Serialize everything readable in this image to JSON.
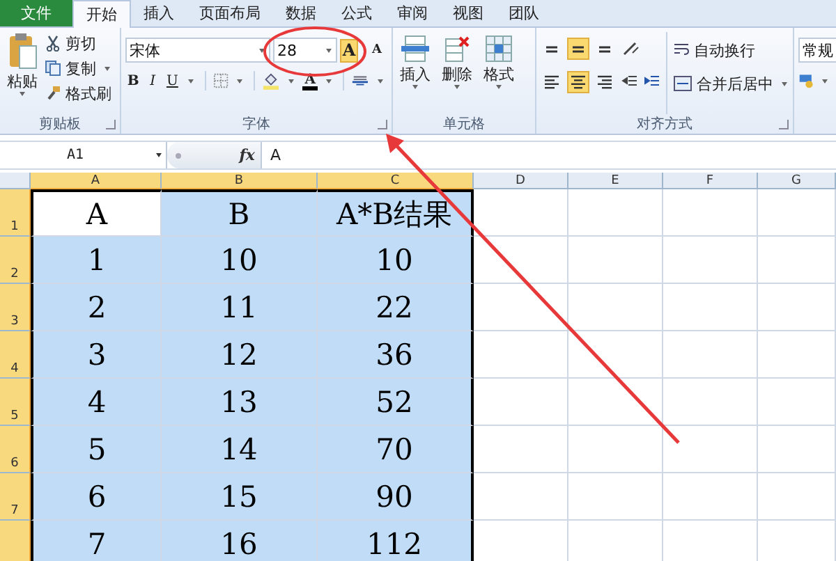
{
  "tabs": [
    {
      "label": "文件",
      "kind": "file",
      "selected": false
    },
    {
      "label": "开始",
      "kind": "tab",
      "selected": true
    },
    {
      "label": "插入",
      "kind": "tab",
      "selected": false
    },
    {
      "label": "页面布局",
      "kind": "tab",
      "selected": false
    },
    {
      "label": "数据",
      "kind": "tab",
      "selected": false
    },
    {
      "label": "公式",
      "kind": "tab",
      "selected": false
    },
    {
      "label": "审阅",
      "kind": "tab",
      "selected": false
    },
    {
      "label": "视图",
      "kind": "tab",
      "selected": false
    },
    {
      "label": "团队",
      "kind": "tab",
      "selected": false
    }
  ],
  "clipboard": {
    "paste": "粘贴",
    "cut": "剪切",
    "copy": "复制",
    "format_painter": "格式刷",
    "label": "剪贴板"
  },
  "font": {
    "font_name": "宋体",
    "font_size": "28",
    "grow": {
      "label": "A",
      "highlighted": true
    },
    "shrink": {
      "label": "A",
      "highlighted": false
    },
    "styles": [
      {
        "label": "B",
        "kind": "bold"
      },
      {
        "label": "I",
        "kind": "italic"
      },
      {
        "label": "U",
        "kind": "underline"
      }
    ],
    "font_color": "A",
    "label": "字体"
  },
  "cells": {
    "insert": "插入",
    "delete": "删除",
    "format": "格式",
    "label": "单元格"
  },
  "alignment": {
    "buttons": [
      {
        "kind": "top",
        "selected": false
      },
      {
        "kind": "middle",
        "selected": true
      },
      {
        "kind": "bottom",
        "selected": false
      },
      {
        "kind": "left",
        "selected": false
      },
      {
        "kind": "center",
        "selected": true
      },
      {
        "kind": "right",
        "selected": false
      }
    ],
    "wrap": "自动换行",
    "merge": "合并后居中",
    "label": "对齐方式"
  },
  "number": {
    "format": "常规"
  },
  "formula_bar": {
    "name_box": "A1",
    "function_label": "fx",
    "value": "A"
  },
  "sheet": {
    "columns": [
      {
        "label": "A",
        "selected": true
      },
      {
        "label": "B",
        "selected": true
      },
      {
        "label": "C",
        "selected": true
      },
      {
        "label": "D",
        "selected": false
      },
      {
        "label": "E",
        "selected": false
      },
      {
        "label": "F",
        "selected": false
      },
      {
        "label": "G",
        "selected": false
      }
    ],
    "rows": [
      {
        "number": "1",
        "selected": true,
        "cells": [
          {
            "text": "A",
            "selected": false
          },
          {
            "text": "B",
            "selected": true
          },
          {
            "text": "A*B结果",
            "selected": true
          }
        ]
      },
      {
        "number": "2",
        "selected": true,
        "cells": [
          {
            "text": "1",
            "selected": true
          },
          {
            "text": "10",
            "selected": true
          },
          {
            "text": "10",
            "selected": true
          }
        ]
      },
      {
        "number": "3",
        "selected": true,
        "cells": [
          {
            "text": "2",
            "selected": true
          },
          {
            "text": "11",
            "selected": true
          },
          {
            "text": "22",
            "selected": true
          }
        ]
      },
      {
        "number": "4",
        "selected": true,
        "cells": [
          {
            "text": "3",
            "selected": true
          },
          {
            "text": "12",
            "selected": true
          },
          {
            "text": "36",
            "selected": true
          }
        ]
      },
      {
        "number": "5",
        "selected": true,
        "cells": [
          {
            "text": "4",
            "selected": true
          },
          {
            "text": "13",
            "selected": true
          },
          {
            "text": "52",
            "selected": true
          }
        ]
      },
      {
        "number": "6",
        "selected": true,
        "cells": [
          {
            "text": "5",
            "selected": true
          },
          {
            "text": "14",
            "selected": true
          },
          {
            "text": "70",
            "selected": true
          }
        ]
      },
      {
        "number": "7",
        "selected": true,
        "cells": [
          {
            "text": "6",
            "selected": true
          },
          {
            "text": "15",
            "selected": true
          },
          {
            "text": "90",
            "selected": true
          }
        ]
      },
      {
        "selected": true,
        "cells": [
          {
            "text": "7",
            "selected": true
          },
          {
            "text": "16",
            "selected": true
          },
          {
            "text": "112",
            "selected": true
          }
        ]
      }
    ]
  }
}
